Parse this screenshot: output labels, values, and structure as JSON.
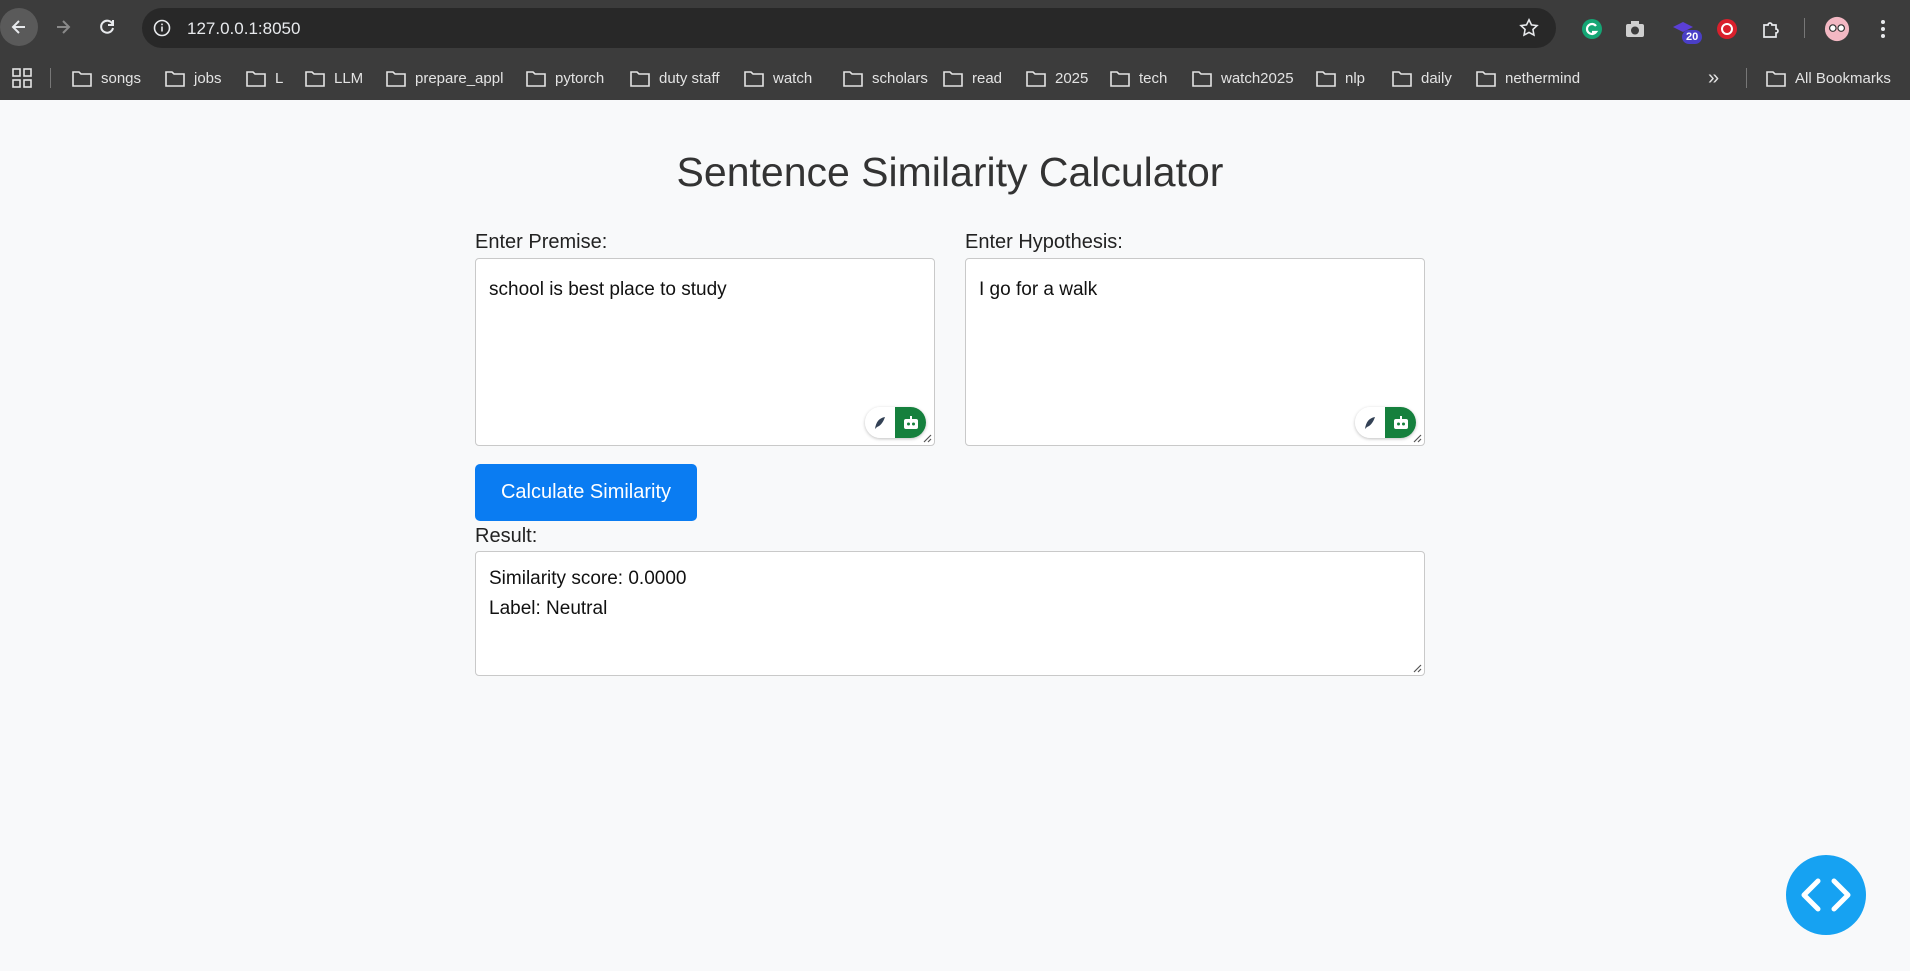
{
  "browser": {
    "url": "127.0.0.1:8050",
    "extension_badge": "20",
    "bookmarks": [
      "songs",
      "jobs",
      "L",
      "LLM",
      "prepare_appl",
      "pytorch",
      "duty staff",
      "watch",
      "scholars",
      "read",
      "2025",
      "tech",
      "watch2025",
      "nlp",
      "daily",
      "nethermind"
    ],
    "all_bookmarks": "All Bookmarks",
    "more_chevron": "»"
  },
  "page": {
    "title": "Sentence Similarity Calculator",
    "premise_label": "Enter Premise:",
    "premise_value": "school is best place to study",
    "hypothesis_label": "Enter Hypothesis:",
    "hypothesis_value": "I go for a walk",
    "calculate_button": "Calculate Similarity",
    "result_label": "Result:",
    "result_line1": "Similarity score: 0.0000",
    "result_line2": "Label: Neutral"
  },
  "colors": {
    "primary_button": "#0a7cf2",
    "fab": "#16a2f2",
    "grammarly_green": "#15803d",
    "chrome_dark": "#3c3c3c"
  }
}
